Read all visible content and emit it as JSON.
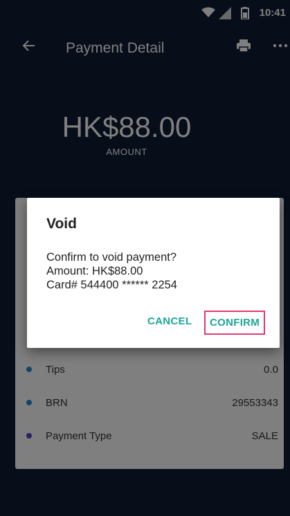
{
  "status_bar": {
    "time": "10:41"
  },
  "app_bar": {
    "title": "Payment Detail"
  },
  "amount": {
    "value": "HK$88.00",
    "label": "AMOUNT"
  },
  "details": [
    {
      "label": "Tips",
      "value": "0.0",
      "color": "#1e8bd3"
    },
    {
      "label": "BRN",
      "value": "29553343",
      "color": "#1e8bd3"
    },
    {
      "label": "Payment Type",
      "value": "SALE",
      "color": "#5b3fc4"
    }
  ],
  "dialog": {
    "title": "Void",
    "line1": "Confirm to void payment?",
    "line2": "Amount: HK$88.00",
    "line3": "Card# 544400 ****** 2254",
    "cancel_label": "CANCEL",
    "confirm_label": "CONFIRM"
  },
  "colors": {
    "accent": "#1aa69a",
    "highlight": "#e5376e",
    "background": "#0f1b33"
  }
}
